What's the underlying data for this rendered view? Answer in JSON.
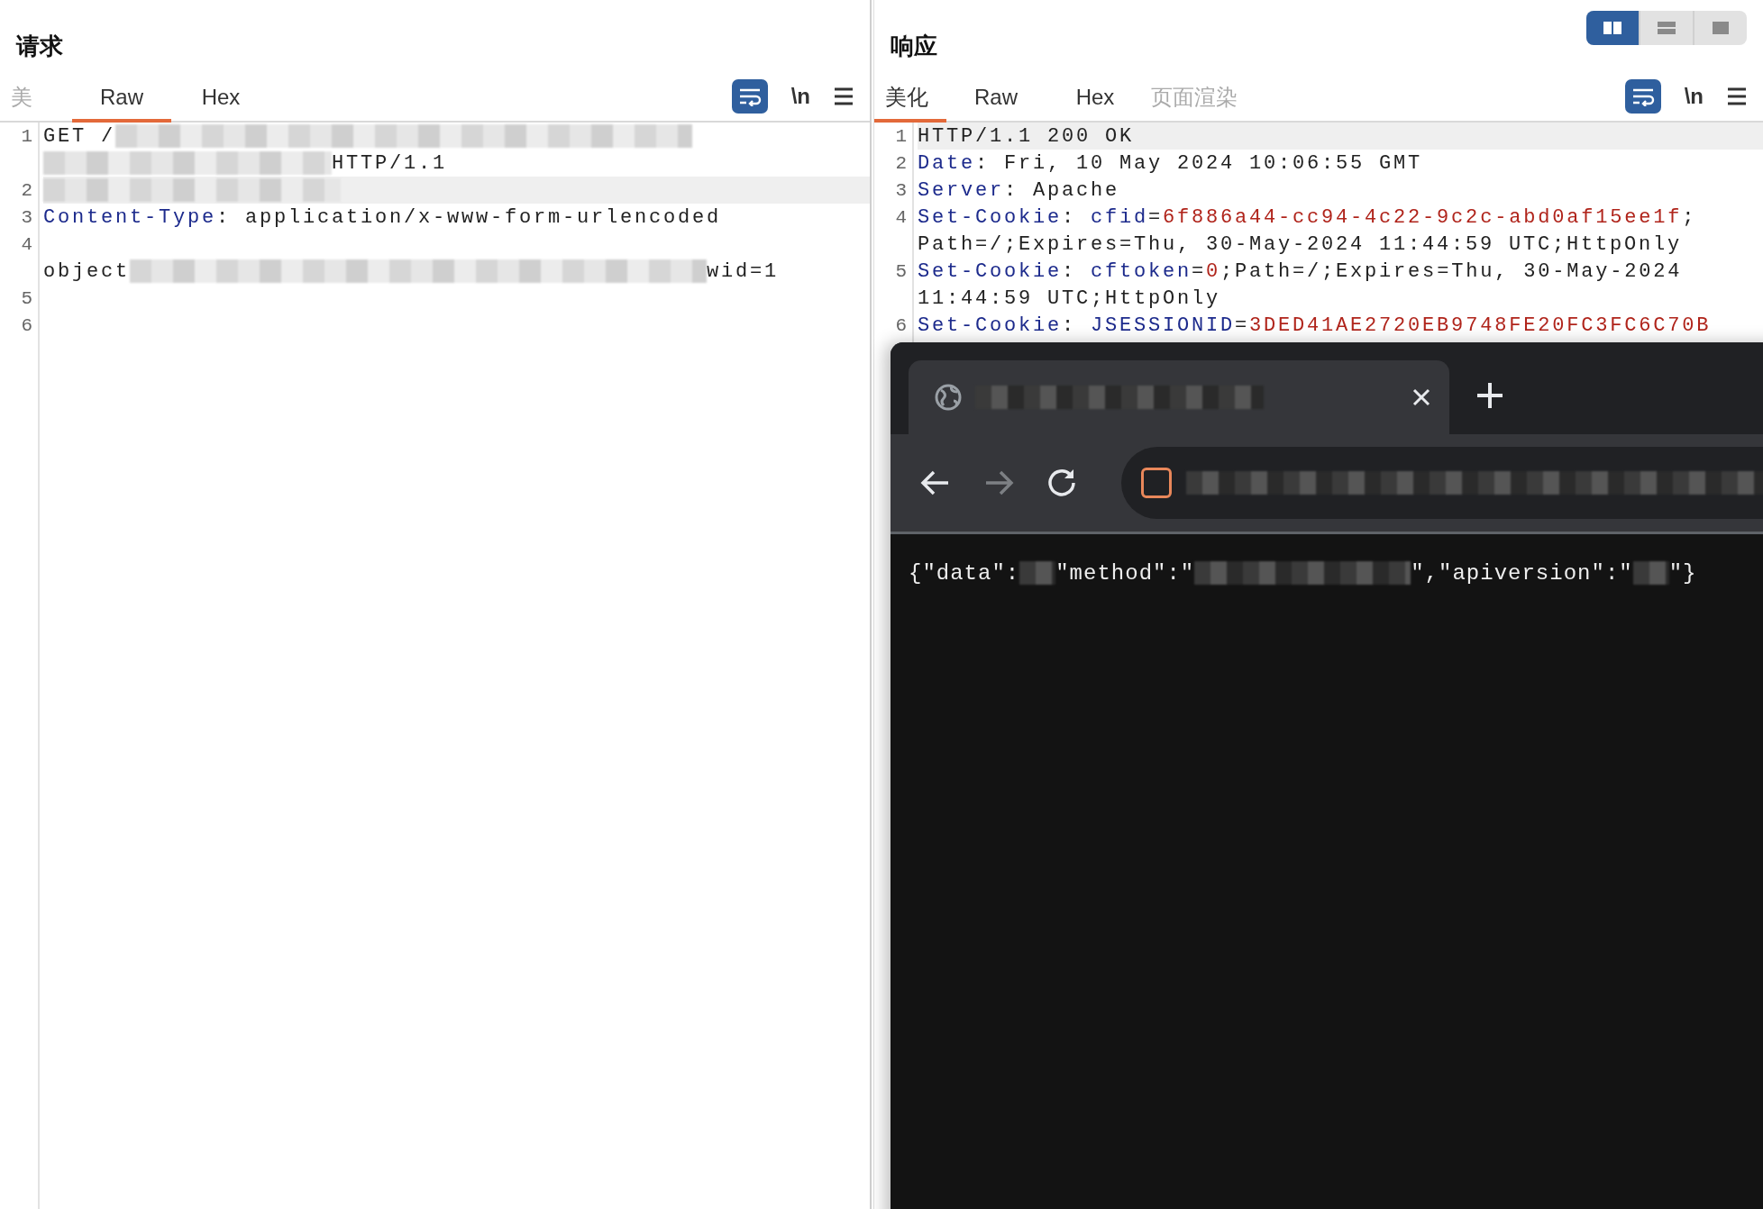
{
  "request": {
    "title": "请求",
    "tabs": [
      {
        "label": "美",
        "selected": false,
        "disabled": true
      },
      {
        "label": "Raw",
        "selected": true,
        "disabled": false
      },
      {
        "label": "Hex",
        "selected": false,
        "disabled": false
      }
    ],
    "toolbar": {
      "wrap_on": true,
      "newline_label": "\\n"
    },
    "lines": [
      {
        "number": "1",
        "highlighted": false,
        "rows": [
          [
            {
              "kind": "text",
              "text": "GET /"
            },
            {
              "kind": "redacted"
            }
          ],
          [
            {
              "kind": "redacted"
            },
            {
              "kind": "text",
              "text": "HTTP/1.1"
            }
          ]
        ]
      },
      {
        "number": "2",
        "highlighted": true,
        "rows": [
          [
            {
              "kind": "redacted"
            }
          ]
        ]
      },
      {
        "number": "3",
        "highlighted": false,
        "rows": [
          [
            {
              "kind": "key",
              "text": "Content-Type"
            },
            {
              "kind": "text",
              "text": ": application/x-www-form-urlencoded"
            }
          ]
        ]
      },
      {
        "number": "4",
        "highlighted": false,
        "rows": [
          [],
          [
            {
              "kind": "text",
              "text": "object"
            },
            {
              "kind": "redacted"
            },
            {
              "kind": "text",
              "text": "wid=1"
            }
          ]
        ]
      },
      {
        "number": "5",
        "highlighted": false,
        "rows": [
          []
        ]
      },
      {
        "number": "6",
        "highlighted": false,
        "rows": [
          []
        ]
      }
    ]
  },
  "response": {
    "title": "响应",
    "layout_modes": [
      {
        "kind": "side-by-side",
        "selected": true
      },
      {
        "kind": "stacked",
        "selected": false
      },
      {
        "kind": "single",
        "selected": false
      }
    ],
    "tabs": [
      {
        "label": "美化",
        "selected": true,
        "disabled": false
      },
      {
        "label": "Raw",
        "selected": false,
        "disabled": false
      },
      {
        "label": "Hex",
        "selected": false,
        "disabled": false
      },
      {
        "label": "页面渲染",
        "selected": false,
        "disabled": true
      }
    ],
    "toolbar": {
      "wrap_on": true,
      "newline_label": "\\n"
    },
    "lines": [
      {
        "number": "1",
        "highlighted": true,
        "rows": [
          [
            {
              "kind": "text",
              "text": "HTTP/1.1 200 OK"
            }
          ]
        ]
      },
      {
        "number": "2",
        "highlighted": false,
        "rows": [
          [
            {
              "kind": "key",
              "text": "Date"
            },
            {
              "kind": "text",
              "text": ": Fri, 10 May 2024 10:06:55 GMT"
            }
          ]
        ]
      },
      {
        "number": "3",
        "highlighted": false,
        "rows": [
          [
            {
              "kind": "key",
              "text": "Server"
            },
            {
              "kind": "text",
              "text": ": Apache"
            }
          ]
        ]
      },
      {
        "number": "4",
        "highlighted": false,
        "rows": [
          [
            {
              "kind": "key",
              "text": "Set-Cookie"
            },
            {
              "kind": "text",
              "text": ": "
            },
            {
              "kind": "key",
              "text": "cfid"
            },
            {
              "kind": "text",
              "text": "="
            },
            {
              "kind": "value",
              "text": "6f886a44-cc94-4c22-9c2c-abd0af15ee1f"
            },
            {
              "kind": "text",
              "text": ";"
            }
          ],
          [
            {
              "kind": "text",
              "text": "Path=/;Expires=Thu, 30-May-2024 11:44:59 UTC;HttpOnly"
            }
          ]
        ]
      },
      {
        "number": "5",
        "highlighted": false,
        "rows": [
          [
            {
              "kind": "key",
              "text": "Set-Cookie"
            },
            {
              "kind": "text",
              "text": ": "
            },
            {
              "kind": "key",
              "text": "cftoken"
            },
            {
              "kind": "text",
              "text": "="
            },
            {
              "kind": "value",
              "text": "0"
            },
            {
              "kind": "text",
              "text": ";Path=/;Expires=Thu, 30-May-2024"
            }
          ],
          [
            {
              "kind": "text",
              "text": "11:44:59 UTC;HttpOnly"
            }
          ]
        ]
      },
      {
        "number": "6",
        "highlighted": false,
        "rows": [
          [
            {
              "kind": "key",
              "text": "Set-Cookie"
            },
            {
              "kind": "text",
              "text": ": "
            },
            {
              "kind": "key",
              "text": "JSESSIONID"
            },
            {
              "kind": "text",
              "text": "="
            },
            {
              "kind": "value",
              "text": "3DED41AE2720EB9748FE20FC3FC6C70B"
            }
          ]
        ]
      }
    ]
  },
  "browser": {
    "tab": {
      "selected": true
    },
    "nav_buttons": [
      {
        "kind": "back",
        "disabled": false
      },
      {
        "kind": "forward",
        "disabled": true
      },
      {
        "kind": "reload",
        "disabled": false
      }
    ],
    "content": [
      {
        "kind": "text",
        "text": "{\"data\":"
      },
      {
        "kind": "redacted"
      },
      {
        "kind": "text",
        "text": "\"method\":\""
      },
      {
        "kind": "redacted"
      },
      {
        "kind": "text",
        "text": "\",\"apiversion\":\""
      },
      {
        "kind": "redacted"
      },
      {
        "kind": "text",
        "text": "\"}"
      }
    ]
  }
}
